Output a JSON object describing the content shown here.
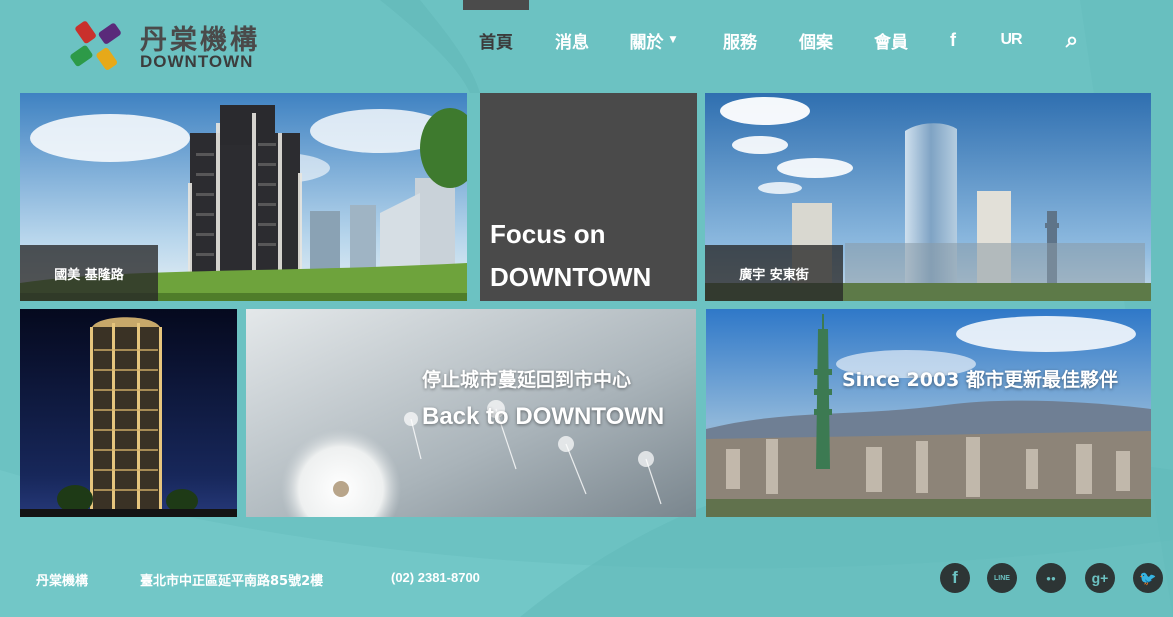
{
  "brand": {
    "name_zh": "丹棠機構",
    "name_en": "DOWNTOWN"
  },
  "nav": {
    "items": [
      {
        "label": "首頁",
        "active": true
      },
      {
        "label": "消息"
      },
      {
        "label": "關於",
        "caret": "▼"
      },
      {
        "label": "服務"
      },
      {
        "label": "個案"
      },
      {
        "label": "會員"
      }
    ],
    "facebook_glyph": "f",
    "ur_glyph": "UR",
    "search_glyph": "⌕"
  },
  "tiles": {
    "guomei": {
      "caption": "國美 基隆路"
    },
    "focus": {
      "line1": "Focus on",
      "line2": "DOWNTOWN"
    },
    "guangyu": {
      "caption": "廣宇 安東街"
    },
    "dandelion": {
      "line1": "停止城市蔓延回到市中心",
      "line2": "Back to DOWNTOWN"
    },
    "taipei": {
      "text": "Since 2003 都市更新最佳夥伴"
    }
  },
  "footer": {
    "company": "丹棠機構",
    "address": "臺北市中正區延平南路85號2樓",
    "phone": "(02) 2381-8700",
    "social": [
      {
        "name": "facebook",
        "glyph": "f"
      },
      {
        "name": "line",
        "glyph": "LINE"
      },
      {
        "name": "wechat",
        "glyph": "●●"
      },
      {
        "name": "google-plus",
        "glyph": "g+"
      },
      {
        "name": "twitter",
        "glyph": "🐦"
      }
    ]
  },
  "colors": {
    "background": "#6cc2c2",
    "dark_tile": "#4a4a4a",
    "active_nav": "#3b3b3b"
  }
}
